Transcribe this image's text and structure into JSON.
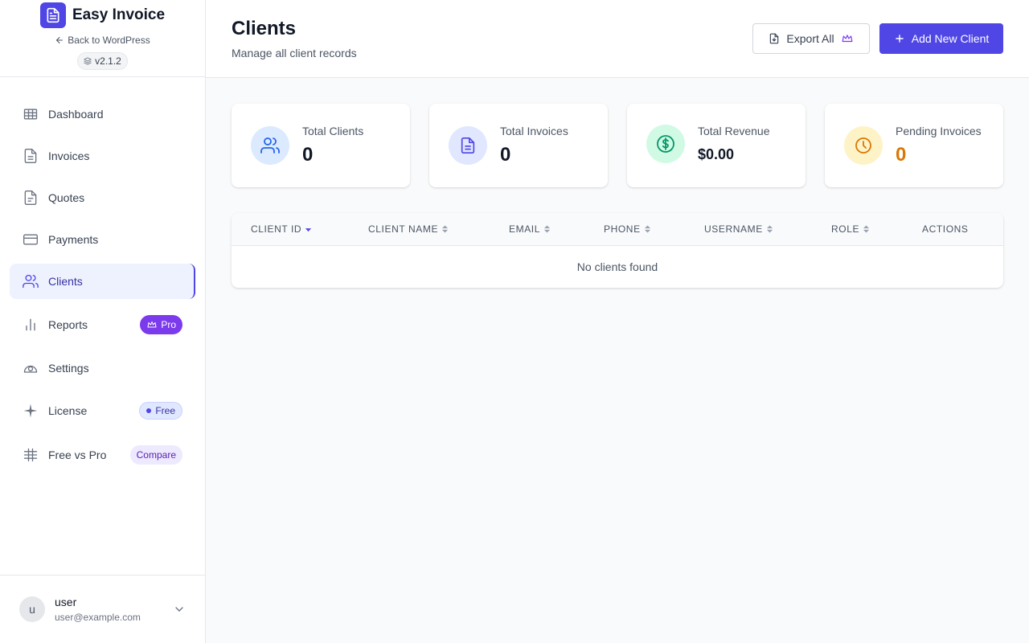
{
  "brand": {
    "name": "Easy Invoice",
    "back_label": "Back to WordPress",
    "version": "v2.1.2"
  },
  "sidebar": {
    "items": [
      {
        "label": "Dashboard",
        "icon": "grid-icon"
      },
      {
        "label": "Invoices",
        "icon": "document-icon"
      },
      {
        "label": "Quotes",
        "icon": "document-icon"
      },
      {
        "label": "Payments",
        "icon": "credit-card-icon"
      },
      {
        "label": "Clients",
        "icon": "users-icon",
        "active": true
      },
      {
        "label": "Reports",
        "icon": "bar-chart-icon",
        "badge": "Pro"
      },
      {
        "label": "Settings",
        "icon": "gear-icon"
      },
      {
        "label": "License",
        "icon": "sparkle-icon",
        "badge": "Free"
      },
      {
        "label": "Free vs Pro",
        "icon": "hash-grid-icon",
        "badge": "Compare"
      }
    ]
  },
  "user": {
    "initial": "u",
    "name": "user",
    "email": "user@example.com"
  },
  "header": {
    "title": "Clients",
    "subtitle": "Manage all client records",
    "export_label": "Export All",
    "add_label": "Add New Client"
  },
  "stats": [
    {
      "label": "Total Clients",
      "value": "0",
      "icon": "users-icon",
      "bg": "#dbeafe",
      "color": "#2563eb"
    },
    {
      "label": "Total Invoices",
      "value": "0",
      "icon": "document-icon",
      "bg": "#e0e7ff",
      "color": "#4f46e5"
    },
    {
      "label": "Total Revenue",
      "value": "$0.00",
      "icon": "dollar-circle-icon",
      "bg": "#d1fae5",
      "color": "#059669"
    },
    {
      "label": "Pending Invoices",
      "value": "0",
      "icon": "clock-icon",
      "bg": "#fef3c7",
      "color": "#d97706"
    }
  ],
  "table": {
    "columns": [
      "Client ID",
      "Client Name",
      "Email",
      "Phone",
      "Username",
      "Role",
      "Actions"
    ],
    "empty_message": "No clients found"
  },
  "colors": {
    "accent": "#4f46e5",
    "pro": "#7c3aed",
    "pending": "#d97706"
  }
}
